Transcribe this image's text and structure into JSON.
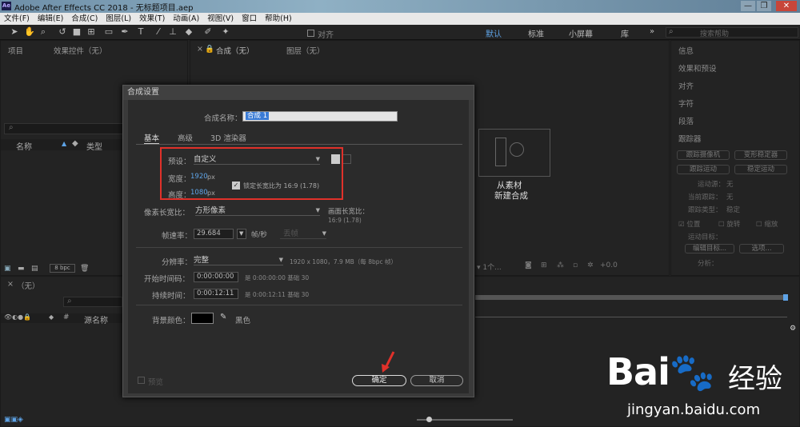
{
  "window": {
    "title": "Adobe After Effects CC 2018 - 无标题项目.aep",
    "ae_badge": "Ae",
    "minimize": "—",
    "maximize": "❐",
    "close": "✕"
  },
  "menu": [
    "文件(F)",
    "编辑(E)",
    "合成(C)",
    "图层(L)",
    "效果(T)",
    "动画(A)",
    "视图(V)",
    "窗口",
    "帮助(H)"
  ],
  "toolbar": {
    "align_label": "对齐",
    "workspaces": [
      "默认",
      "标准",
      "小屏幕",
      "库"
    ],
    "more": "»",
    "search_placeholder": "搜索帮助"
  },
  "project_panel": {
    "tab_project": "项目",
    "tab_effects": "效果控件（无）",
    "col_name": "名称",
    "col_type": "类型",
    "bpc": "8 bpc"
  },
  "comp_panel": {
    "tab_comp": "合成（无）",
    "tab_layer": "图层（无）",
    "placeholder_line1": "从素材",
    "placeholder_line2": "新建合成"
  },
  "right_panel": {
    "items": [
      "信息",
      "效果和预设",
      "对齐",
      "字符",
      "段落",
      "跟踪器"
    ],
    "track_camera": "跟踪摄像机",
    "warp_stabilizer": "变形稳定器",
    "track_motion": "跟踪运动",
    "stabilize_motion": "稳定运动",
    "motion_source": "运动源：",
    "motion_source_val": "无",
    "current_track": "当前跟踪：",
    "current_track_val": "无",
    "track_type": "跟踪类型：",
    "track_type_val": "稳定",
    "position": "位置",
    "rotation": "旋转",
    "scale": "缩放",
    "motion_target": "运动目标：",
    "edit_target": "编辑目标...",
    "options": "选项...",
    "analyze": "分析："
  },
  "timeline": {
    "tab": "（无）",
    "col_source": "源名称"
  },
  "dialog": {
    "title": "合成设置",
    "comp_name_label": "合成名称：",
    "comp_name_value": "合成 1",
    "tabs": [
      "基本",
      "高级",
      "3D 渲染器"
    ],
    "preset_label": "预设：",
    "preset_value": "自定义",
    "width_label": "宽度：",
    "width_value": "1920",
    "height_label": "高度：",
    "height_value": "1080",
    "px": "px",
    "lock_aspect": "锁定长宽比为 16:9 (1.78)",
    "pixel_aspect_label": "像素长宽比：",
    "pixel_aspect_value": "方形像素",
    "frame_aspect_label": "画面长宽比：",
    "frame_aspect_value": "16:9 (1.78)",
    "frame_rate_label": "帧速率：",
    "frame_rate_value": "29.684",
    "fps_unit": "帧/秒",
    "drop_frame": "丢帧",
    "resolution_label": "分辨率：",
    "resolution_value": "完整",
    "resolution_info": "1920 x 1080，7.9 MB（每 8bpc 帧）",
    "start_tc_label": "开始时间码：",
    "start_tc_value": "0:00:00:00",
    "start_tc_info": "是 0:00:00:00 基础 30",
    "duration_label": "持续时间：",
    "duration_value": "0:00:12:11",
    "duration_info": "是 0:00:12:11 基础 30",
    "bg_color_label": "背景颜色：",
    "bg_color_name": "黑色",
    "preview": "预览",
    "ok": "确定",
    "cancel": "取消"
  },
  "watermark": {
    "brand": "Bai",
    "brand_cn": "经验",
    "url": "jingyan.baidu.com"
  },
  "colors": {
    "accent_blue": "#5ea3e6",
    "highlight": "#e0312a",
    "panel_bg": "#232323",
    "dialog_bg": "#2b2b2b"
  }
}
